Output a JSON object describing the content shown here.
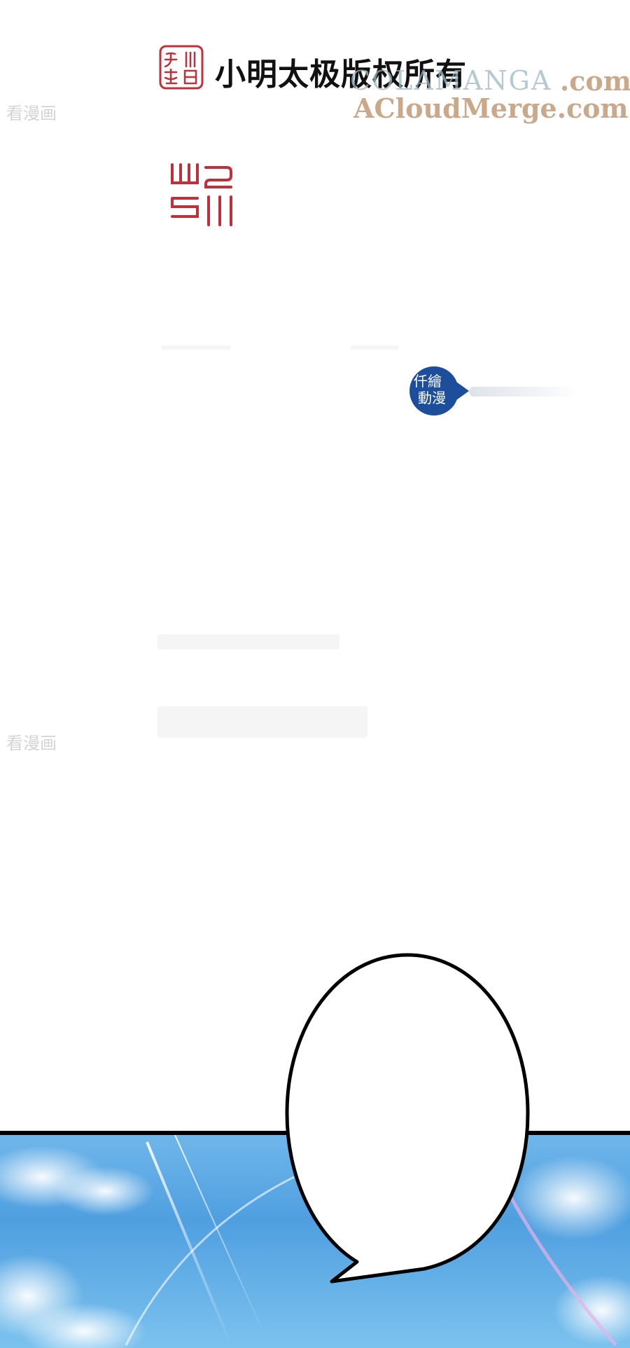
{
  "header": {
    "copyright_text": "小明太极版权所有",
    "seal_small_text": "小明太极",
    "seal_large_text": "山羽",
    "publisher_badge": [
      "仟繪",
      "動漫"
    ]
  },
  "watermarks": {
    "side_1": "看漫画",
    "side_2": "看漫画",
    "manga_site": "COLAMANGA",
    "manga_tld": ".com",
    "acloud": "ACloudMerge.com"
  },
  "colors": {
    "seal_red": "#c0303a",
    "badge_blue": "#1d4e9c",
    "watermark_gray": "#d4d4d4",
    "watermark_tan": "#c9a98a",
    "sky_blue": "#4f9fe0"
  },
  "speech_bubble": {
    "text": ""
  }
}
